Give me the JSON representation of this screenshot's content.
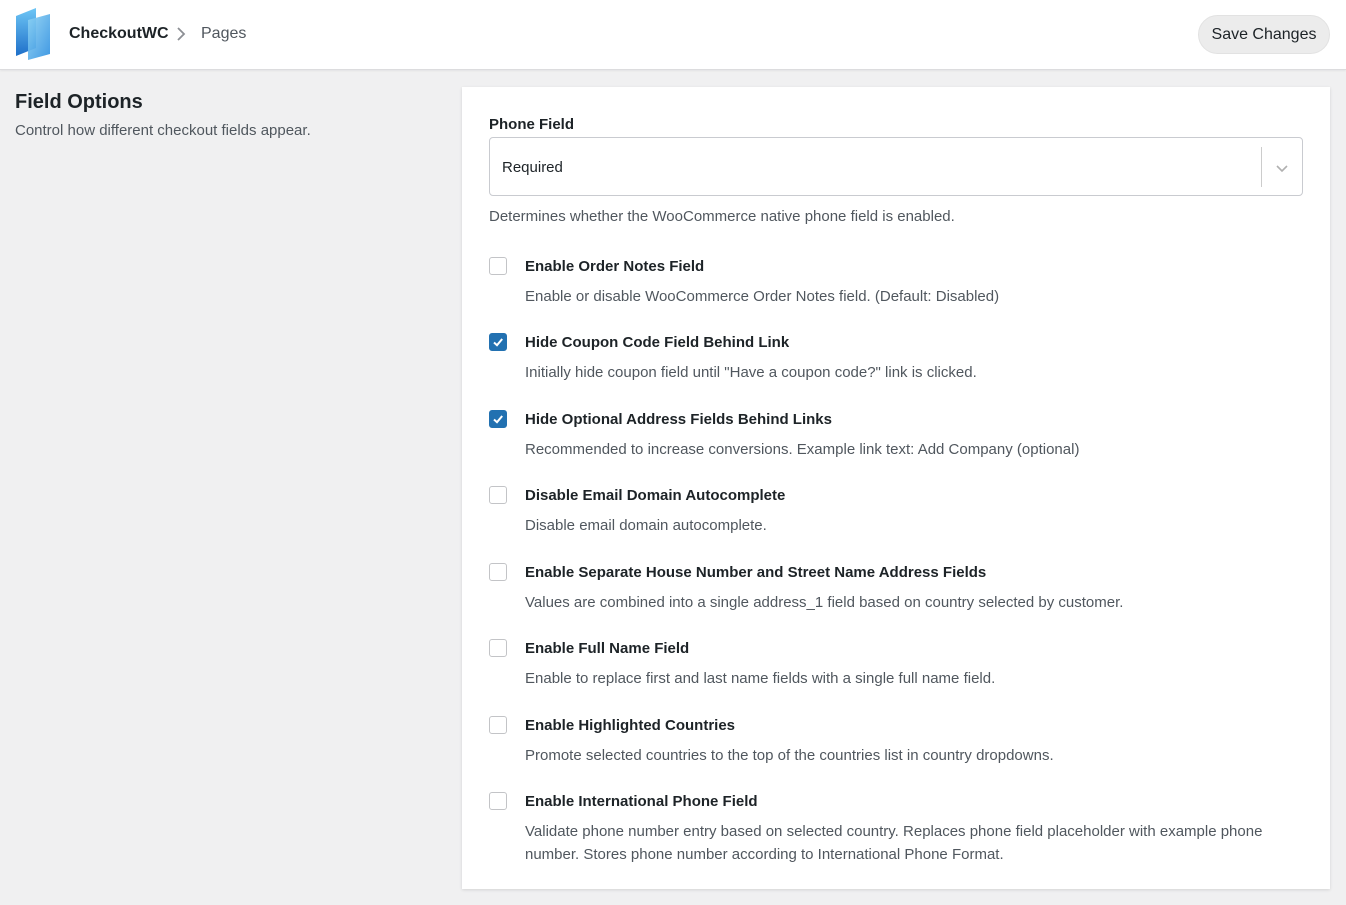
{
  "header": {
    "brand": "CheckoutWC",
    "breadcrumb_page": "Pages",
    "save_label": "Save Changes"
  },
  "section": {
    "title": "Field Options",
    "description": "Control how different checkout fields appear."
  },
  "phone_field": {
    "label": "Phone Field",
    "selected": "Required",
    "help": "Determines whether the WooCommerce native phone field is enabled."
  },
  "options": [
    {
      "title": "Enable Order Notes Field",
      "description": "Enable or disable WooCommerce Order Notes field. (Default: Disabled)",
      "checked": false
    },
    {
      "title": "Hide Coupon Code Field Behind Link",
      "description": "Initially hide coupon field until \"Have a coupon code?\" link is clicked.",
      "checked": true
    },
    {
      "title": "Hide Optional Address Fields Behind Links",
      "description": "Recommended to increase conversions. Example link text: Add Company (optional)",
      "checked": true
    },
    {
      "title": "Disable Email Domain Autocomplete",
      "description": "Disable email domain autocomplete.",
      "checked": false
    },
    {
      "title": "Enable Separate House Number and Street Name Address Fields",
      "description": "Values are combined into a single address_1 field based on country selected by customer.",
      "checked": false
    },
    {
      "title": "Enable Full Name Field",
      "description": "Enable to replace first and last name fields with a single full name field.",
      "checked": false
    },
    {
      "title": "Enable Highlighted Countries",
      "description": "Promote selected countries to the top of the countries list in country dropdowns.",
      "checked": false
    },
    {
      "title": "Enable International Phone Field",
      "description": "Validate phone number entry based on selected country. Replaces phone field placeholder with example phone number. Stores phone number according to International Phone Format.",
      "checked": false
    }
  ],
  "colors": {
    "accent": "#2271b1",
    "background": "#f0f0f1"
  },
  "icons": {
    "logo": "checkoutwc-logo-icon",
    "breadcrumb_separator": "chevron-right-icon",
    "select_arrow": "chevron-down-icon",
    "checkbox_check": "checkmark-icon"
  }
}
